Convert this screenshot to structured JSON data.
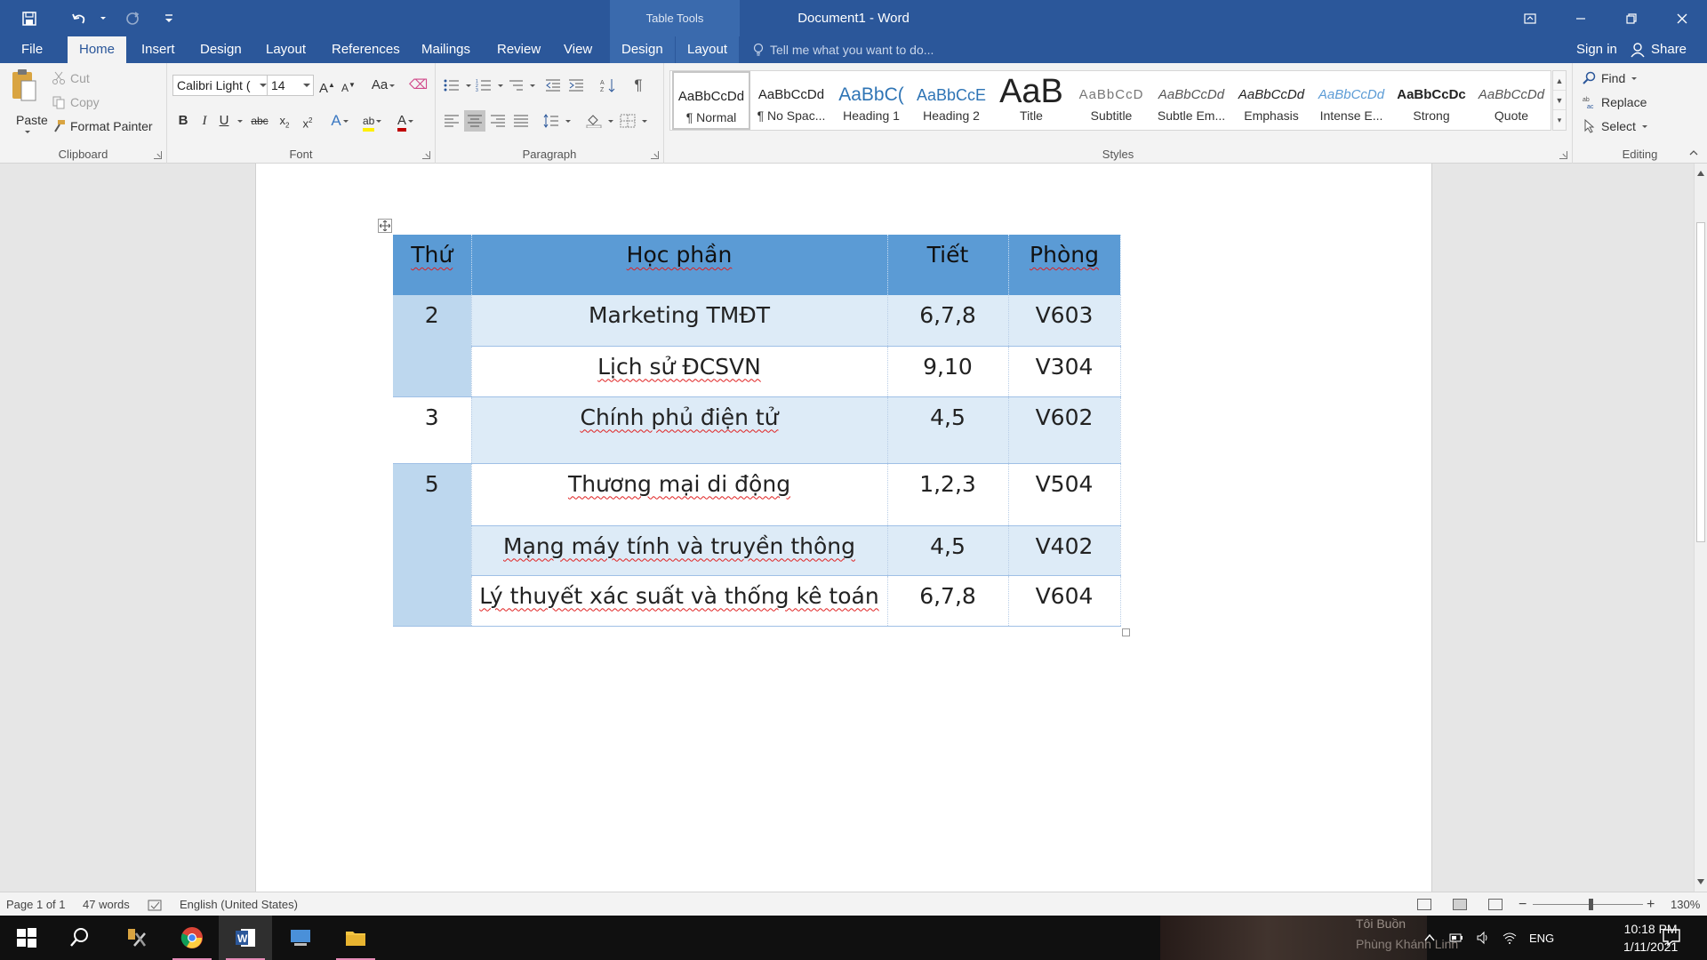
{
  "window": {
    "title": "Document1 - Word",
    "contextual_group": "Table Tools"
  },
  "tabs": [
    {
      "label": "File"
    },
    {
      "label": "Home"
    },
    {
      "label": "Insert"
    },
    {
      "label": "Design"
    },
    {
      "label": "Layout"
    },
    {
      "label": "References"
    },
    {
      "label": "Mailings"
    },
    {
      "label": "Review"
    },
    {
      "label": "View"
    },
    {
      "label": "Design"
    },
    {
      "label": "Layout"
    }
  ],
  "tell_me": "Tell me what you want to do...",
  "account": {
    "sign_in": "Sign in",
    "share": "Share"
  },
  "clipboard": {
    "label": "Clipboard",
    "paste": "Paste",
    "cut": "Cut",
    "copy": "Copy",
    "format_painter": "Format Painter"
  },
  "font": {
    "label": "Font",
    "family": "Calibri Light (",
    "size": "14",
    "change_case": "Aa"
  },
  "paragraph": {
    "label": "Paragraph"
  },
  "styles": {
    "label": "Styles",
    "items": [
      {
        "sample": "AaBbCcDd",
        "name": "¶ Normal"
      },
      {
        "sample": "AaBbCcDd",
        "name": "¶ No Spac..."
      },
      {
        "sample": "AaBbC(",
        "name": "Heading 1"
      },
      {
        "sample": "AaBbCcE",
        "name": "Heading 2"
      },
      {
        "sample": "AaB",
        "name": "Title"
      },
      {
        "sample": "AaBbCcD",
        "name": "Subtitle"
      },
      {
        "sample": "AaBbCcDd",
        "name": "Subtle Em..."
      },
      {
        "sample": "AaBbCcDd",
        "name": "Emphasis"
      },
      {
        "sample": "AaBbCcDd",
        "name": "Intense E..."
      },
      {
        "sample": "AaBbCcDc",
        "name": "Strong"
      },
      {
        "sample": "AaBbCcDd",
        "name": "Quote"
      }
    ]
  },
  "editing": {
    "label": "Editing",
    "find": "Find",
    "replace": "Replace",
    "select": "Select"
  },
  "table": {
    "headers": [
      "Thứ",
      "Học phần",
      "Tiết",
      "Phòng"
    ],
    "rows": [
      {
        "thu": "2",
        "hoc": "Marketing TMĐT",
        "tiet": "6,7,8",
        "phong": "V603"
      },
      {
        "thu": "",
        "hoc": "Lịch sử ĐCSVN",
        "tiet": "9,10",
        "phong": "V304"
      },
      {
        "thu": "3",
        "hoc": "Chính phủ điện tử",
        "tiet": "4,5",
        "phong": "V602"
      },
      {
        "thu": "5",
        "hoc": "Thương mại di động",
        "tiet": "1,2,3",
        "phong": "V504"
      },
      {
        "thu": "",
        "hoc": "Mạng máy tính và truyền thông",
        "tiet": "4,5",
        "phong": "V402"
      },
      {
        "thu": "",
        "hoc": "Lý thuyết xác suất và thống kê toán",
        "tiet": "6,7,8",
        "phong": "V604"
      }
    ]
  },
  "status": {
    "page": "Page 1 of 1",
    "words": "47 words",
    "language": "English (United States)",
    "zoom": "130%"
  },
  "taskbar": {
    "media_title": "Tôi Buồn",
    "media_artist": "Phùng Khánh Linh",
    "language": "ENG",
    "time": "10:18 PM",
    "date": "1/11/2021"
  },
  "colors": {
    "title_bar": "#2b579a",
    "table_header": "#5b9bd5",
    "table_band": "#ddebf7",
    "first_col": "#bdd7ee"
  }
}
